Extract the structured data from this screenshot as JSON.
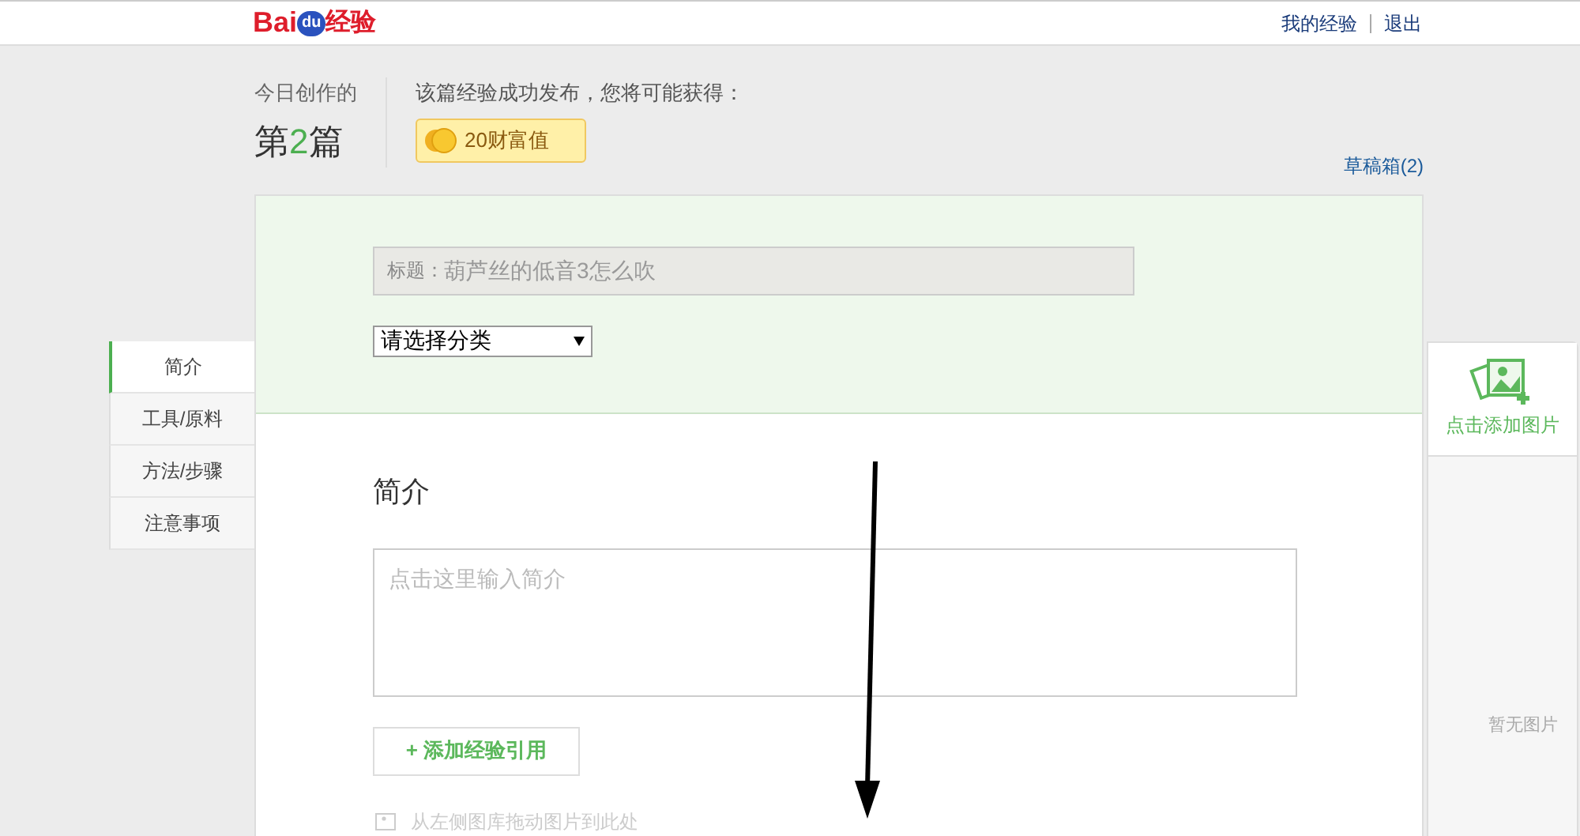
{
  "header": {
    "logo": {
      "latin_a": "Bai",
      "latin_b": "du",
      "cjk": "经验"
    },
    "links": [
      "我的经验",
      "退出"
    ]
  },
  "stats": {
    "label": "今日创作的",
    "count_prefix": "第",
    "count": "2",
    "count_suffix": "篇",
    "reward_note": "该篇经验成功发布，您将可能获得：",
    "reward": "20财富值",
    "drafts": "草稿箱(2)"
  },
  "form": {
    "title_label": "标题：",
    "title_value": "葫芦丝的低音3怎么吹",
    "category": "请选择分类"
  },
  "nav": [
    {
      "label": "简介",
      "selected": true
    },
    {
      "label": "工具/原料",
      "selected": false
    },
    {
      "label": "方法/步骤",
      "selected": false
    },
    {
      "label": "注意事项",
      "selected": false
    }
  ],
  "section": {
    "heading": "简介",
    "placeholder": "点击这里输入简介",
    "add_button": "+ 添加经验引用",
    "drag_hint": "从左侧图库拖动图片到此处"
  },
  "image_panel": {
    "add_label": "点击添加图片",
    "empty_label": "暂无图片"
  }
}
